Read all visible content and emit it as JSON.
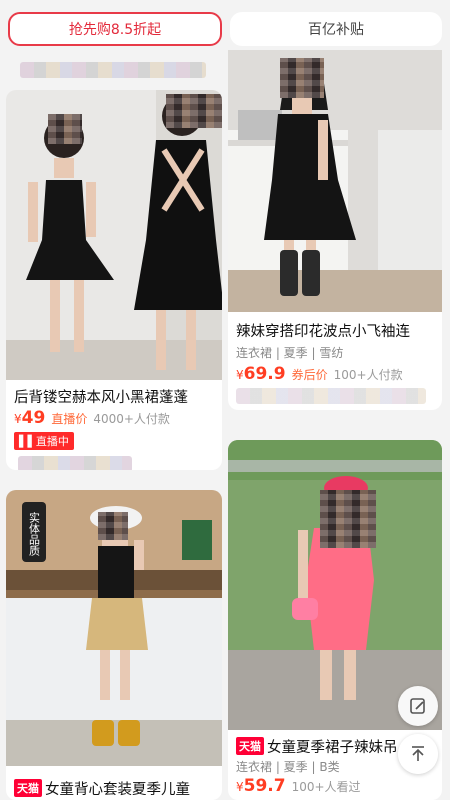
{
  "top_buttons": {
    "left": "抢先购8.5折起",
    "right": "百亿补贴"
  },
  "products": [
    {
      "title": "后背镂空赫本风小黑裙蓬蓬",
      "price_symbol": "¥",
      "price": "49",
      "price_tag": "直播价",
      "buyers": "4000+人付款",
      "badge": "直播中"
    },
    {
      "title": "辣妹穿搭印花波点小飞袖连",
      "tags": "连衣裙 | 夏季 | 雪纺",
      "price_symbol": "¥",
      "price": "69.9",
      "price_tag": "券后价",
      "buyers": "100+人付款"
    },
    {
      "shop_badge": "天猫",
      "title": "女童背心套装夏季儿童",
      "photo_badge": "实体品质"
    },
    {
      "shop_badge": "天猫",
      "title": "女童夏季裙子辣妹吊",
      "tags": "连衣裙 | 夏季 | B类",
      "price_symbol": "¥",
      "price": "59.7",
      "buyers": "100+人看过"
    }
  ],
  "icons": [
    "live-icon",
    "edit-icon",
    "back-to-top-icon"
  ]
}
